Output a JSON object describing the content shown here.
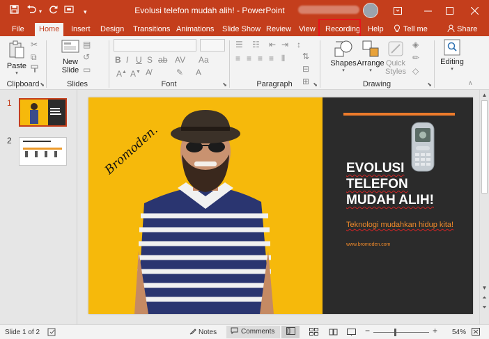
{
  "app": {
    "title": "Evolusi telefon mudah alih!  -  PowerPoint",
    "brand_color": "#c43e1c"
  },
  "quick_access": {
    "icons": [
      "save-icon",
      "undo-icon",
      "undo-dropdown-icon",
      "redo-icon",
      "customize-icon"
    ]
  },
  "window_controls": {
    "icons": [
      "ribbon-display-icon",
      "minimize-icon",
      "maximize-icon",
      "close-icon"
    ]
  },
  "tabs": {
    "file": "File",
    "home": "Home",
    "insert": "Insert",
    "design": "Design",
    "transitions": "Transitions",
    "animations": "Animations",
    "slide_show": "Slide Show",
    "review": "Review",
    "view": "View",
    "recording": "Recording",
    "help": "Help",
    "tell_me": "Tell me",
    "share": "Share",
    "active": "Home",
    "highlighted": "Recording"
  },
  "ribbon": {
    "clipboard": {
      "label": "Clipboard",
      "paste": "Paste"
    },
    "slides": {
      "label": "Slides",
      "new_slide_line1": "New",
      "new_slide_line2": "Slide"
    },
    "font": {
      "label": "Font"
    },
    "paragraph": {
      "label": "Paragraph"
    },
    "drawing": {
      "label": "Drawing",
      "shapes": "Shapes",
      "arrange": "Arrange",
      "quick_styles_line1": "Quick",
      "quick_styles_line2": "Styles"
    },
    "editing": {
      "label": "Editing"
    }
  },
  "thumbnails": {
    "slide1_num": "1",
    "slide2_num": "2",
    "selected": 1
  },
  "slide": {
    "title_line1": "EVOLUSI",
    "title_line2": "TELEFON",
    "title_line3": "MUDAH ALIH!",
    "subtitle": "Teknologi mudahkan hidup kita!",
    "url": "www.bromoden.com",
    "signature": "Bromoden.",
    "left_color": "#f6b90b",
    "right_color": "#2b2b2b",
    "accent_color": "#ec7b2b"
  },
  "statusbar": {
    "slide_counter": "Slide 1 of 2",
    "notes": "Notes",
    "comments": "Comments",
    "zoom": "54%"
  }
}
